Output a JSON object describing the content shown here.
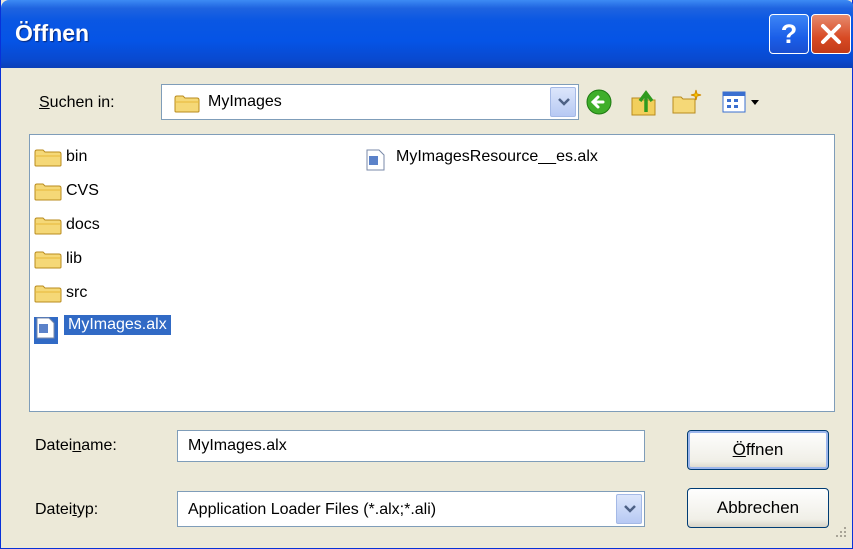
{
  "window": {
    "title": "Öffnen"
  },
  "lookin": {
    "label_pre": "",
    "label_u": "S",
    "label_post": "uchen in:",
    "value": "MyImages"
  },
  "files": [
    {
      "name": "bin",
      "type": "folder"
    },
    {
      "name": "CVS",
      "type": "folder"
    },
    {
      "name": "docs",
      "type": "folder"
    },
    {
      "name": "lib",
      "type": "folder"
    },
    {
      "name": "src",
      "type": "folder"
    },
    {
      "name": "MyImages.alx",
      "type": "file",
      "selected": true
    },
    {
      "name": "MyImagesResource__es.alx",
      "type": "file"
    }
  ],
  "filename": {
    "label_pre": "Datei",
    "label_u": "n",
    "label_post": "ame:",
    "value": "MyImages.alx"
  },
  "filetype": {
    "label_pre": "Datei",
    "label_u": "t",
    "label_post": "yp:",
    "value": "Application Loader Files (*.alx;*.ali)"
  },
  "buttons": {
    "open_u": "Ö",
    "open_rest": "ffnen",
    "cancel": "Abbrechen"
  },
  "icons": {
    "help": "help-icon",
    "close": "close-icon",
    "back": "back-arrow-icon",
    "up": "up-folder-icon",
    "newfolder": "new-folder-icon",
    "view": "view-menu-icon"
  }
}
